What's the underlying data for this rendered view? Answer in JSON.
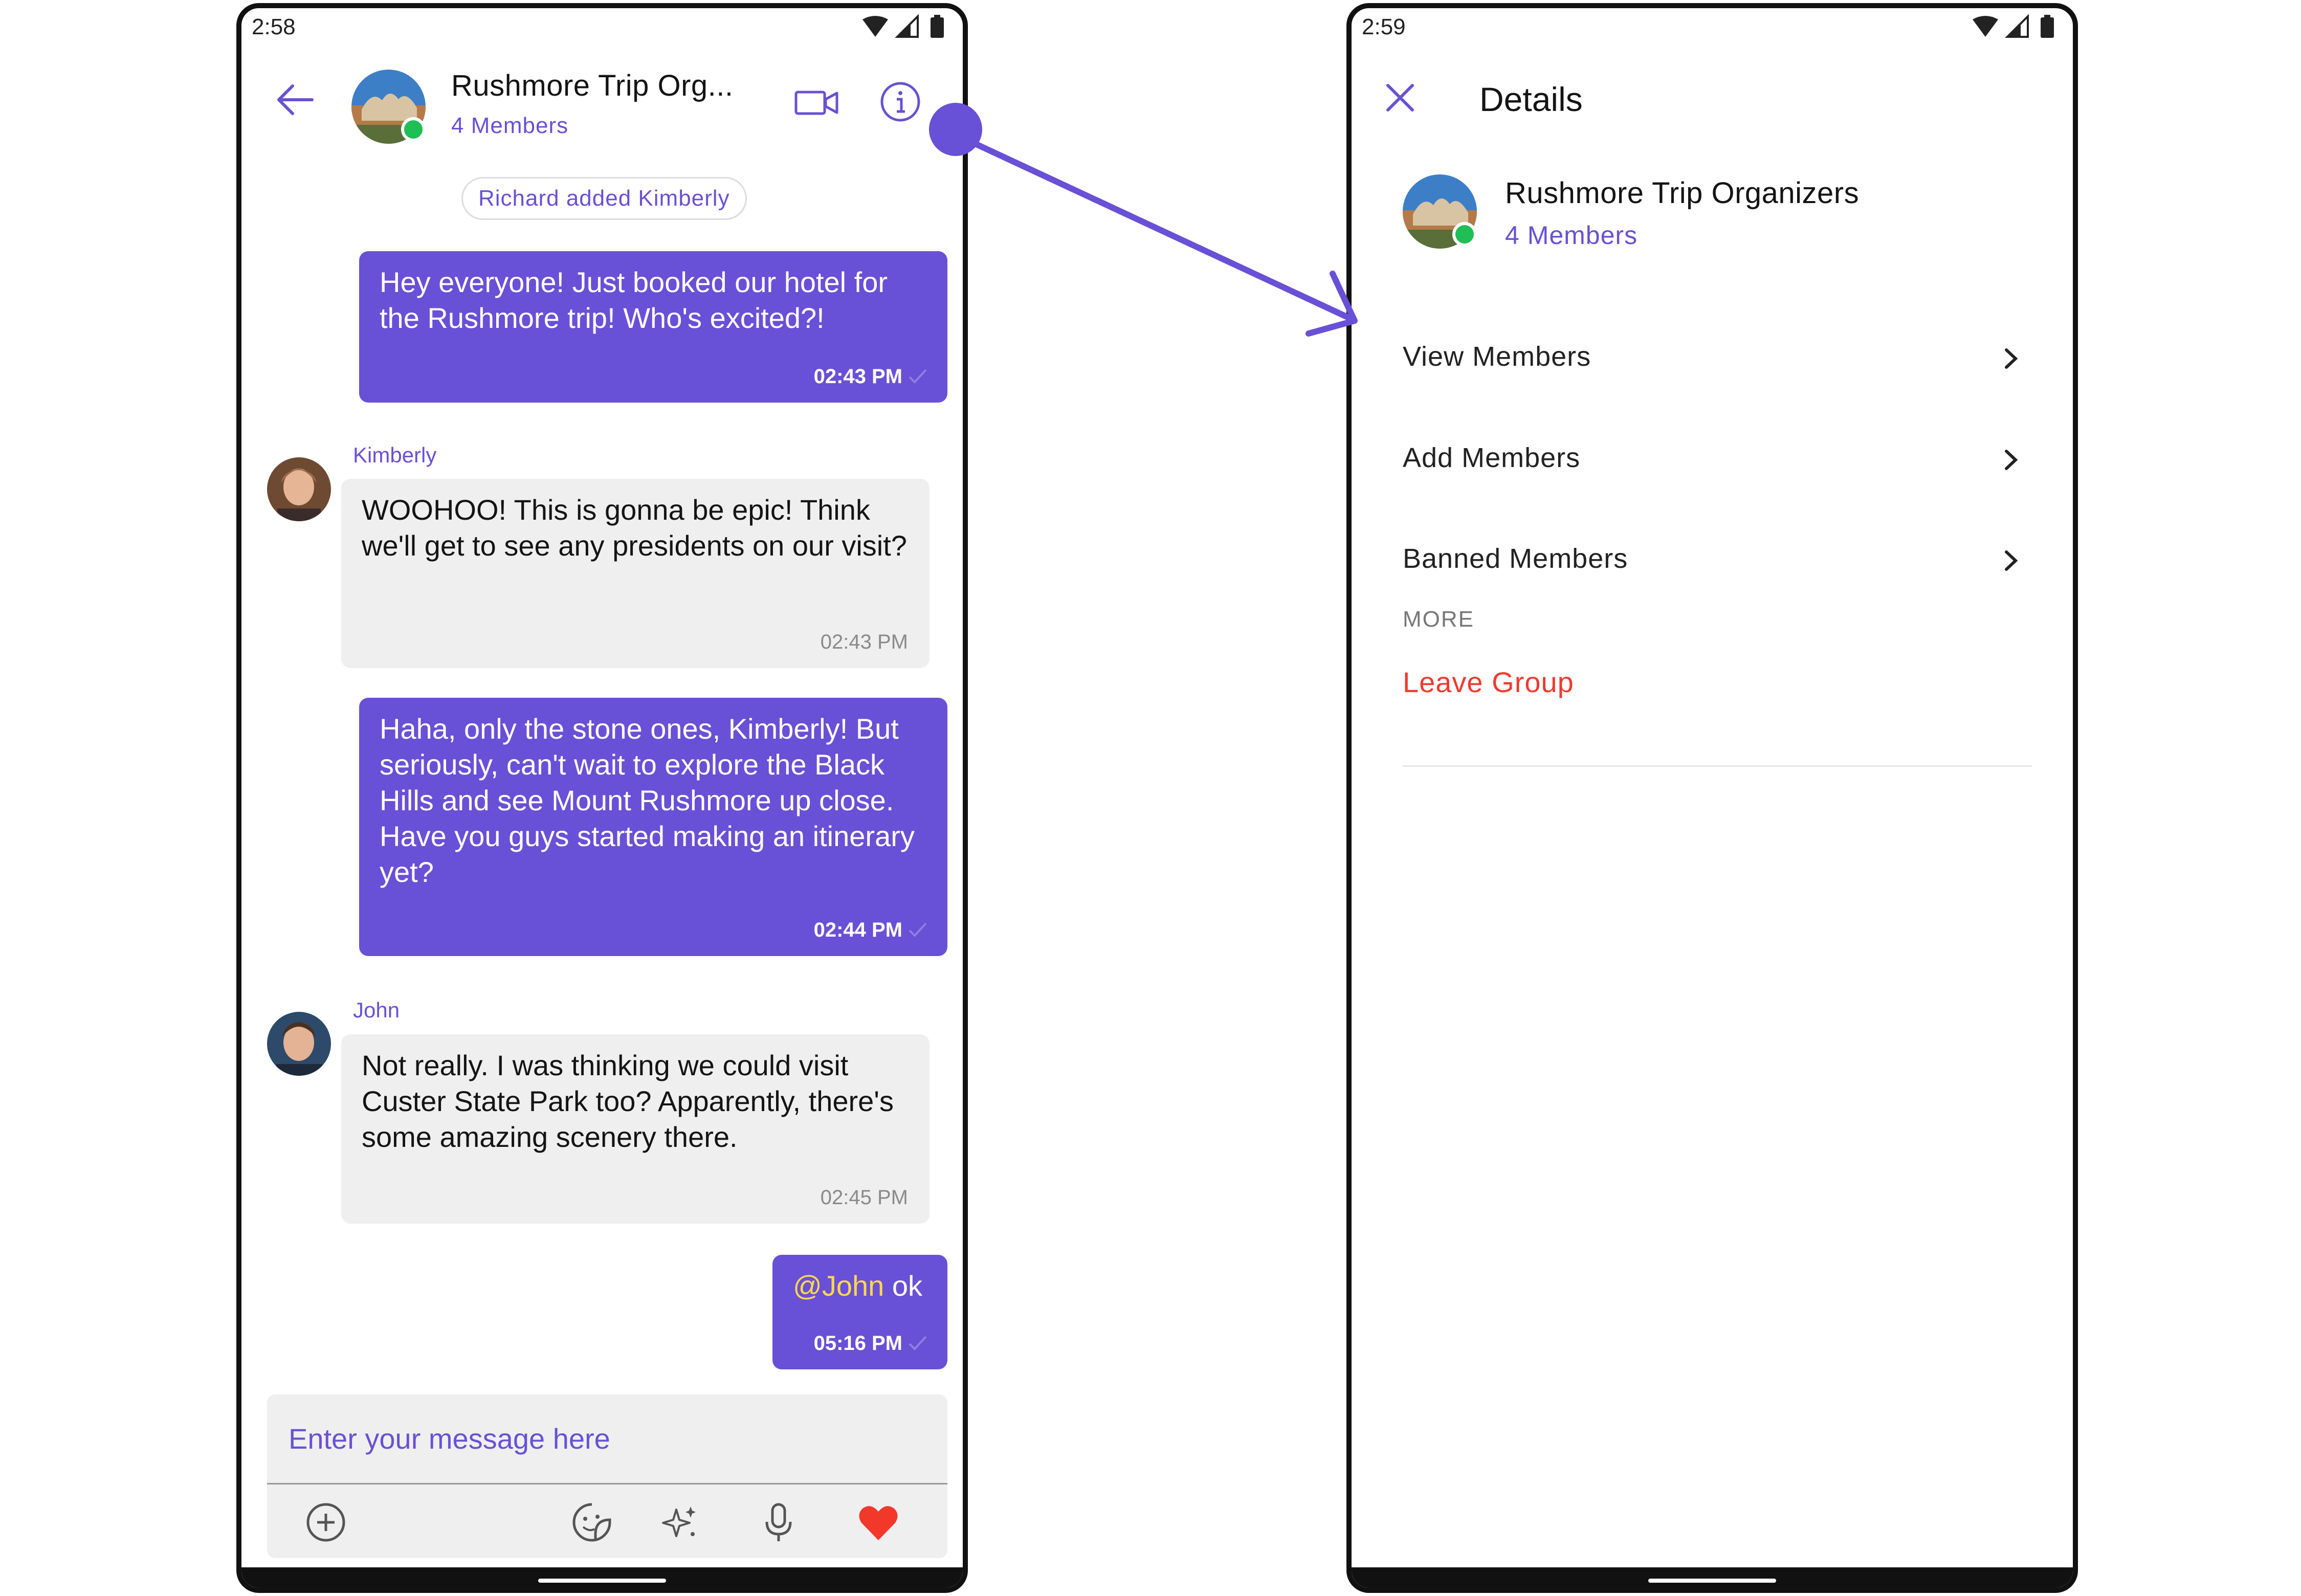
{
  "colors": {
    "accent": "#6851d6",
    "incoming": "#efefef",
    "online": "#1fbf55",
    "danger": "#f03a2e",
    "heart": "#f2382b"
  },
  "chat_screen": {
    "status_time": "2:58",
    "header": {
      "title": "Rushmore Trip Org...",
      "subtitle": "4 Members"
    },
    "action_message": "Richard added Kimberly",
    "messages": [
      {
        "type": "outgoing",
        "text": "Hey everyone!   Just booked our hotel for the Rushmore trip!  Who's excited?!",
        "time": "02:43 PM"
      },
      {
        "type": "incoming",
        "sender": "Kimberly",
        "text": "WOOHOO!  This is gonna be epic!  Think we'll get to see any presidents on our visit?",
        "time": "02:43 PM"
      },
      {
        "type": "outgoing",
        "text": " Haha, only the stone ones, Kimberly!  But seriously, can't wait to explore the Black Hills and see Mount Rushmore up close.  Have you guys started making an itinerary yet?",
        "time": "02:44 PM"
      },
      {
        "type": "incoming",
        "sender": "John",
        "text": "Not really.  I was thinking we could visit Custer State Park too?  Apparently, there's some amazing scenery there.",
        "time": "02:45 PM"
      },
      {
        "type": "outgoing",
        "mention": "@John",
        "text": " ok",
        "time": "05:16 PM"
      }
    ],
    "composer": {
      "placeholder": "Enter your message here"
    },
    "icons": [
      "back-arrow-icon",
      "video-call-icon",
      "info-icon",
      "add-icon",
      "sticker-icon",
      "ai-sparkle-icon",
      "microphone-icon",
      "heart-icon"
    ]
  },
  "details_screen": {
    "status_time": "2:59",
    "title": "Details",
    "group_name": "Rushmore Trip Organizers",
    "member_count": "4 Members",
    "menu": [
      {
        "label": "View Members"
      },
      {
        "label": "Add Members"
      },
      {
        "label": "Banned Members"
      }
    ],
    "more_section": "MORE",
    "leave_label": "Leave Group"
  }
}
